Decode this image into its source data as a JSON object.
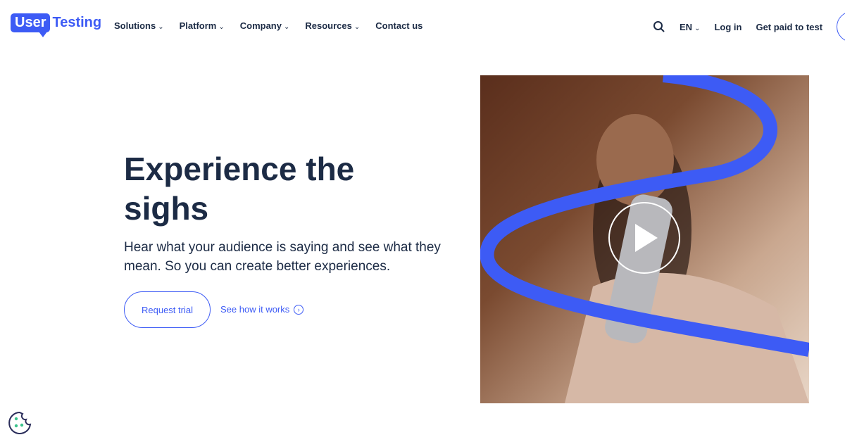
{
  "brand": {
    "logo_box": "User",
    "logo_text": "Testing",
    "accent": "#3d5bf5",
    "text_color": "#1c2b45"
  },
  "nav": {
    "items": [
      {
        "label": "Solutions",
        "dropdown": true
      },
      {
        "label": "Platform",
        "dropdown": true
      },
      {
        "label": "Company",
        "dropdown": true
      },
      {
        "label": "Resources",
        "dropdown": true
      },
      {
        "label": "Contact us",
        "dropdown": false
      }
    ]
  },
  "header_right": {
    "search_icon": "search-icon",
    "language": "EN",
    "login": "Log in",
    "get_paid": "Get paid to test"
  },
  "hero": {
    "title": "Experience the sighs",
    "subtitle": "Hear what your audience is saying and see what they mean. So you can create better experiences.",
    "primary_button": "Request trial",
    "secondary_link": "See how it works",
    "media_icon": "play-icon"
  },
  "cookie": {
    "icon": "cookie-icon"
  }
}
